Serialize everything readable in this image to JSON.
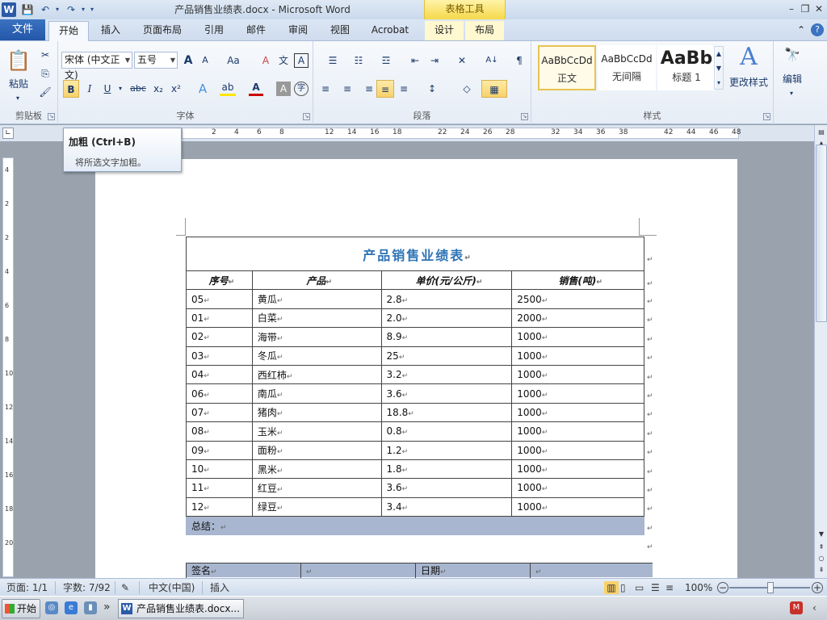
{
  "titlebar": {
    "app_icon": "W",
    "title": "产品销售业绩表.docx - Microsoft Word",
    "table_tools": "表格工具",
    "save_icon": "💾",
    "undo_icon": "↶",
    "redo_icon": "↷",
    "customize_icon": "▾",
    "minimize": "–",
    "restore": "❐",
    "close": "✕"
  },
  "tabs": {
    "file": "文件",
    "home": "开始",
    "insert": "插入",
    "page_layout": "页面布局",
    "references": "引用",
    "mailings": "邮件",
    "review": "审阅",
    "view": "视图",
    "acrobat": "Acrobat",
    "design": "设计",
    "layout": "布局",
    "collapse_icon": "⌃",
    "help_icon": "?"
  },
  "ribbon": {
    "clipboard": {
      "label": "剪贴板",
      "paste": "粘贴",
      "paste_arrow": "▾",
      "cut_icon": "✂",
      "copy_icon": "⎘",
      "format_painter_icon": "🖌"
    },
    "font": {
      "label": "字体",
      "font_name": "宋体 (中文正文)",
      "font_size": "五号",
      "grow": "A",
      "shrink": "A",
      "change_case": "Aa",
      "clear_format": "A",
      "phonetic": "文",
      "char_border": "A",
      "bold": "B",
      "italic": "I",
      "underline": "U",
      "strike": "abc",
      "subscript": "x₂",
      "superscript": "x²",
      "text_effect": "A",
      "highlight": "ab",
      "font_color": "A",
      "char_shading": "A",
      "enclose": "字"
    },
    "paragraph": {
      "label": "段落",
      "bullets": "☰",
      "numbering": "☷",
      "multilevel": "☲",
      "decrease_indent": "⇤",
      "increase_indent": "⇥",
      "chinese_layout": "✕",
      "sort": "A↓",
      "show_marks": "¶",
      "align_left": "≡",
      "center": "≡",
      "align_right": "≡",
      "justify": "≡",
      "distributed": "≡",
      "line_spacing": "↕",
      "shading": "◇",
      "borders": "▦"
    },
    "styles": {
      "label": "样式",
      "normal_sample": "AaBbCcDd",
      "normal_name": "正文",
      "nospacing_sample": "AaBbCcDd",
      "nospacing_name": "无间隔",
      "heading1_sample": "AaBb",
      "heading1_name": "标题 1",
      "change_styles": "更改样式",
      "change_styles_icon": "A"
    },
    "editing": {
      "label": "编辑",
      "icon": "🔭"
    }
  },
  "tooltip": {
    "title": "加粗 (Ctrl+B)",
    "description": "将所选文字加粗。"
  },
  "ruler": {
    "marks": [
      "2",
      "4",
      "6",
      "8",
      "12",
      "14",
      "16",
      "18",
      "22",
      "24",
      "26",
      "28",
      "32",
      "34",
      "36",
      "38",
      "42",
      "44",
      "46",
      "48"
    ]
  },
  "vruler": {
    "marks": [
      "4",
      "2",
      "2",
      "4",
      "6",
      "8",
      "10",
      "12",
      "14",
      "16",
      "18",
      "20"
    ]
  },
  "document": {
    "table_title": "产品销售业绩表",
    "headers": [
      "序号",
      "产品",
      "单价(元/公斤)",
      "销售(吨)"
    ],
    "rows": [
      [
        "05",
        "黄瓜",
        "2.8",
        "2500"
      ],
      [
        "01",
        "白菜",
        "2.0",
        "2000"
      ],
      [
        "02",
        "海带",
        "8.9",
        "1000"
      ],
      [
        "03",
        "冬瓜",
        "25",
        "1000"
      ],
      [
        "04",
        "西红柿",
        "3.2",
        "1000"
      ],
      [
        "06",
        "南瓜",
        "3.6",
        "1000"
      ],
      [
        "07",
        "猪肉",
        "18.8",
        "1000"
      ],
      [
        "08",
        "玉米",
        "0.8",
        "1000"
      ],
      [
        "09",
        "面粉",
        "1.2",
        "1000"
      ],
      [
        "10",
        "黑米",
        "1.8",
        "1000"
      ],
      [
        "11",
        "红豆",
        "3.6",
        "1000"
      ],
      [
        "12",
        "绿豆",
        "3.4",
        "1000"
      ]
    ],
    "summary": "总结：",
    "sign": "签名",
    "date": "日期",
    "para_mark": "↵"
  },
  "statusbar": {
    "page": "页面: 1/1",
    "words": "字数: 7/92",
    "language": "中文(中国)",
    "insert_mode": "插入",
    "zoom": "100%",
    "zoom_out": "−",
    "zoom_in": "+"
  },
  "taskbar": {
    "start": "开始",
    "more": "»",
    "word_task": "产品销售业绩表.docx..."
  },
  "colors": {
    "title_text": "#2e74b5",
    "summary_fill": "#a8b6cf",
    "highlight": "#f8d26a"
  }
}
